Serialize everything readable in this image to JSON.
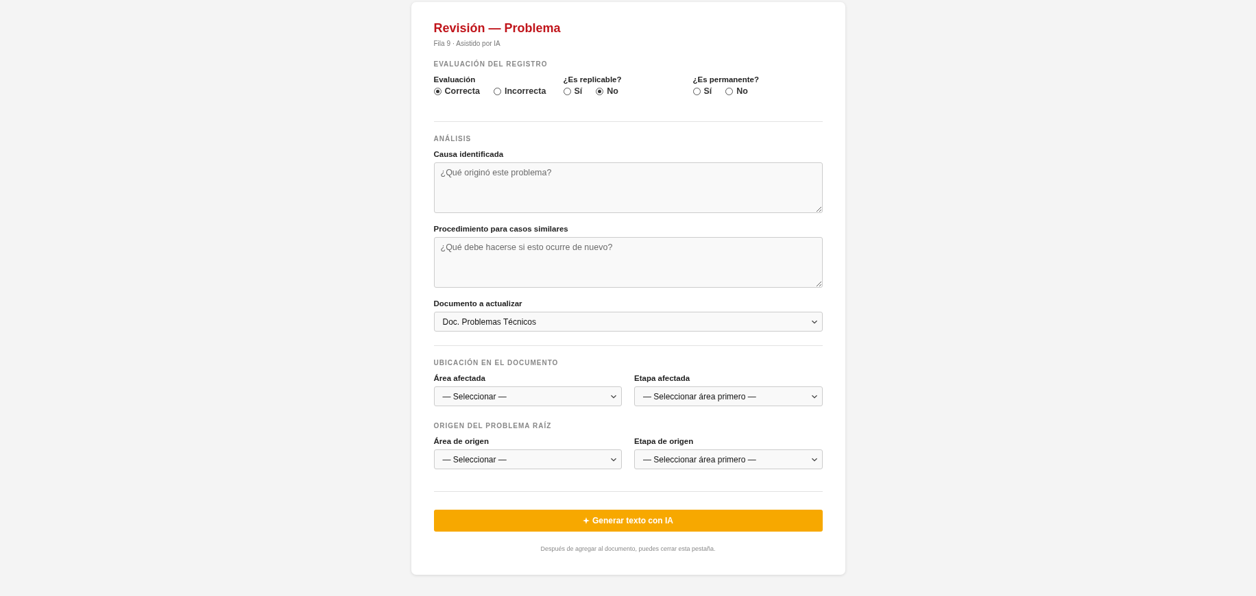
{
  "header": {
    "title": "Revisión — Problema",
    "subtitle": "Fila 9 · Asistido por IA"
  },
  "sections": [
    {
      "heading": "EVALUACIÓN DEL REGISTRO",
      "kind": "radios",
      "divider_after": true,
      "groups": [
        {
          "label": "Evaluación",
          "options": [
            {
              "label": "Correcta",
              "selected": true
            },
            {
              "label": "Incorrecta",
              "selected": false
            }
          ]
        },
        {
          "label": "¿Es replicable?",
          "options": [
            {
              "label": "Sí",
              "selected": false
            },
            {
              "label": "No",
              "selected": true
            }
          ]
        },
        {
          "label": "¿Es permanente?",
          "options": [
            {
              "label": "Sí",
              "selected": false
            },
            {
              "label": "No",
              "selected": false
            }
          ]
        }
      ]
    },
    {
      "heading": "ANÁLISIS",
      "kind": "stack",
      "divider_after": true,
      "fields": [
        {
          "kind": "textarea",
          "label": "Causa identificada",
          "placeholder": "¿Qué originó este problema?"
        },
        {
          "kind": "textarea",
          "label": "Procedimiento para casos similares",
          "placeholder": "¿Qué debe hacerse si esto ocurre de nuevo?"
        },
        {
          "kind": "select",
          "label": "Documento a actualizar",
          "value": "Doc. Problemas Técnicos"
        }
      ]
    },
    {
      "heading": "UBICACIÓN EN EL DOCUMENTO",
      "kind": "grid",
      "divider_after": false,
      "fields": [
        {
          "kind": "select",
          "label": "Área afectada",
          "value": "— Seleccionar —"
        },
        {
          "kind": "select",
          "label": "Etapa afectada",
          "value": "— Seleccionar área primero —"
        }
      ]
    },
    {
      "heading": "ORIGEN DEL PROBLEMA RAÍZ",
      "kind": "grid",
      "divider_after": true,
      "fields": [
        {
          "kind": "select",
          "label": "Área de origen",
          "value": "— Seleccionar —"
        },
        {
          "kind": "select",
          "label": "Etapa de origen",
          "value": "— Seleccionar área primero —"
        }
      ]
    }
  ],
  "action_button": {
    "label": "Generar texto con IA"
  },
  "footer_note": "Después de agregar al documento, puedes cerrar esta pestaña."
}
